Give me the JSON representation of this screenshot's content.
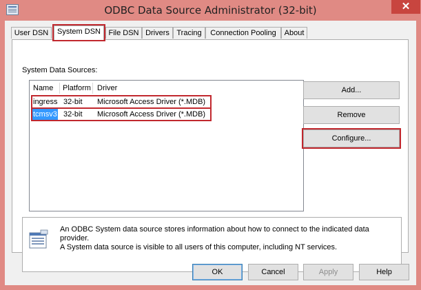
{
  "window": {
    "title": "ODBC Data Source Administrator (32-bit)",
    "close_glyph": "✕"
  },
  "tabs": [
    {
      "label": "User DSN"
    },
    {
      "label": "System DSN",
      "active": true
    },
    {
      "label": "File DSN"
    },
    {
      "label": "Drivers"
    },
    {
      "label": "Tracing"
    },
    {
      "label": "Connection Pooling"
    },
    {
      "label": "About"
    }
  ],
  "system_dsn": {
    "section_label": "System Data Sources:",
    "columns": [
      "Name",
      "Platform",
      "Driver"
    ],
    "rows": [
      {
        "name": "ingress",
        "platform": "32-bit",
        "driver": "Microsoft Access Driver (*.MDB)"
      },
      {
        "name": "tcmsv3",
        "platform": "32-bit",
        "driver": "Microsoft Access Driver (*.MDB)",
        "selected": true
      }
    ],
    "buttons": {
      "add": "Add...",
      "remove": "Remove",
      "configure": "Configure..."
    },
    "info": {
      "icon": "data-source-icon",
      "text_line1": "An ODBC System data source stores information about how to connect to the indicated data provider.",
      "text_line2": "A System data source is visible to all users of this computer, including NT services."
    }
  },
  "dialog_buttons": {
    "ok": "OK",
    "cancel": "Cancel",
    "apply": "Apply",
    "help": "Help"
  },
  "colors": {
    "highlight_outline": "#c1272d",
    "selection": "#3399ff",
    "title_bar": "#e08a84"
  }
}
